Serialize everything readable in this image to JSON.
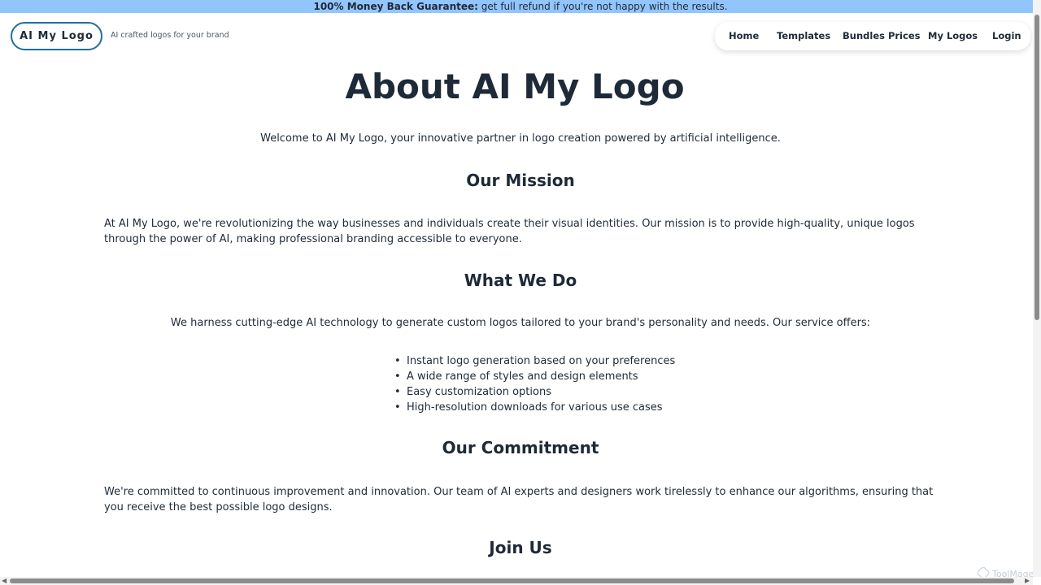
{
  "banner": {
    "bold_text": "100% Money Back Guarantee:",
    "text": " get full refund if you're not happy with the results."
  },
  "header": {
    "logo_text": "AI My Logo",
    "tagline": "AI crafted logos for your brand"
  },
  "nav": {
    "items": [
      {
        "label": "Home"
      },
      {
        "label": "Templates"
      },
      {
        "label": "Bundles Prices"
      },
      {
        "label": "My Logos"
      },
      {
        "label": "Login"
      }
    ]
  },
  "main": {
    "title": "About AI My Logo",
    "intro": "Welcome to AI My Logo, your innovative partner in logo creation powered by artificial intelligence.",
    "sections": [
      {
        "heading": "Our Mission",
        "text": "At AI My Logo, we're revolutionizing the way businesses and individuals create their visual identities. Our mission is to provide high-quality, unique logos through the power of AI, making professional branding accessible to everyone."
      },
      {
        "heading": "What We Do",
        "text": "We harness cutting-edge AI technology to generate custom logos tailored to your brand's personality and needs. Our service offers:",
        "bullets": [
          "Instant logo generation based on your preferences",
          "A wide range of styles and design elements",
          "Easy customization options",
          "High-resolution downloads for various use cases"
        ]
      },
      {
        "heading": "Our Commitment",
        "text": "We're committed to continuous improvement and innovation. Our team of AI experts and designers work tirelessly to enhance our algorithms, ensuring that you receive the best possible logo designs."
      },
      {
        "heading": "Join Us"
      }
    ]
  },
  "watermark": {
    "text": "ToolMage",
    "icon": "toolmage-logo-icon"
  },
  "colors": {
    "banner_bg": "#93c5fd",
    "logo_border": "#1f6f9a",
    "text": "#1e2a38"
  }
}
